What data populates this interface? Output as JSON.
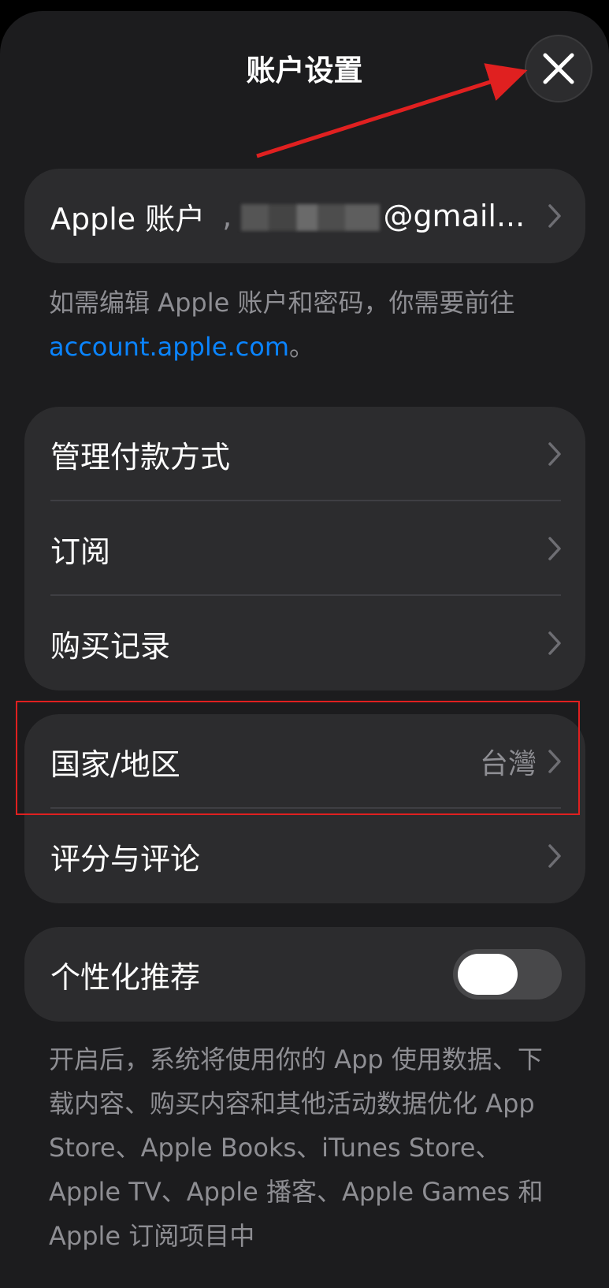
{
  "header": {
    "title": "账户设置"
  },
  "account_row": {
    "label": "Apple 账户",
    "email": "@gmail..."
  },
  "account_note": {
    "text_before": "如需编辑 Apple 账户和密码，你需要前往 ",
    "link": "account.apple.com",
    "text_after": "。"
  },
  "group_one": {
    "items": [
      {
        "label": "管理付款方式"
      },
      {
        "label": "订阅"
      },
      {
        "label": "购买记录"
      }
    ]
  },
  "group_two": {
    "items": [
      {
        "label": "国家/地区",
        "value": "台灣"
      },
      {
        "label": "评分与评论"
      }
    ]
  },
  "personalization": {
    "label": "个性化推荐",
    "enabled": false
  },
  "personalization_note": {
    "text": "开启后，系统将使用你的 App 使用数据、下载内容、购买内容和其他活动数据优化 App Store、Apple Books、iTunes Store、Apple TV、Apple 播客、Apple Games 和 Apple 订阅项目中"
  },
  "annotations": {
    "arrow_color": "#e02020",
    "highlight_color": "#e02020"
  }
}
